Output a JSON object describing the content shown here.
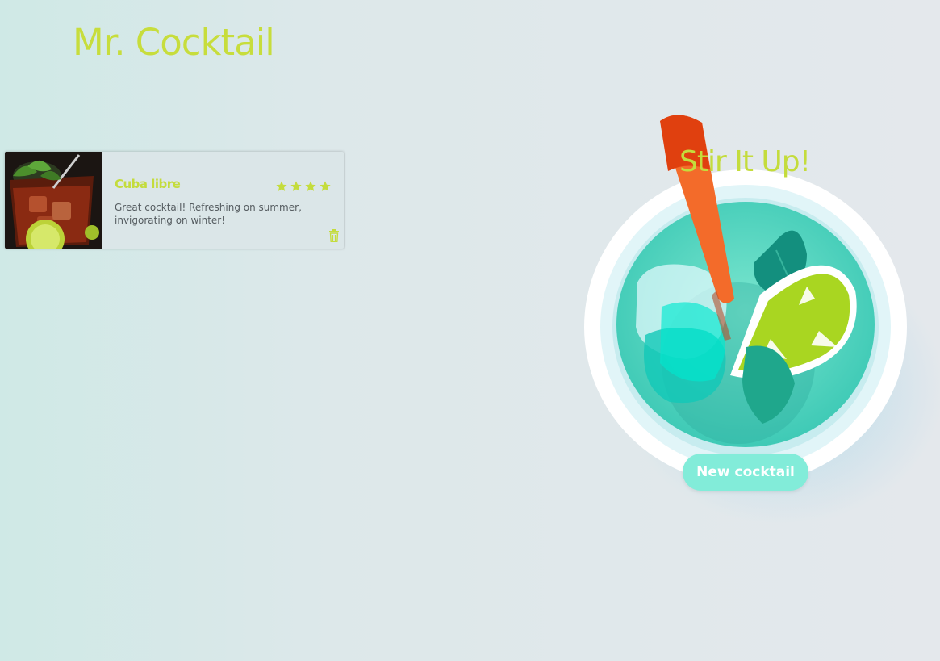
{
  "app": {
    "brand": "Mr. Cocktail"
  },
  "cocktails": [
    {
      "name": "Cuba libre",
      "description": "Great cocktail! Refreshing on summer, invigorating on winter!",
      "rating": 4,
      "rating_max": 4,
      "photo_icon": "cocktail-photo",
      "delete_icon": "trash-icon"
    }
  ],
  "hero": {
    "title": "Stir It Up!",
    "illustration": "cocktail-glass-illustration",
    "button_label": "New cocktail"
  },
  "colors": {
    "accent": "#c4dc3c",
    "button": "#82ecd9",
    "button_text": "#ffffff",
    "body_text": "#555c60"
  }
}
